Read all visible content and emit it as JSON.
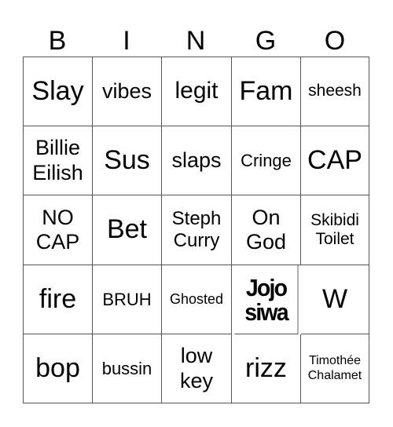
{
  "header": {
    "letters": [
      "B",
      "I",
      "N",
      "G",
      "O"
    ]
  },
  "board": {
    "rows": [
      [
        "Slay",
        "vibes",
        "legit",
        "Fam",
        "sheesh"
      ],
      [
        "Billie Eilish",
        "Sus",
        "slaps",
        "Cringe",
        "CAP"
      ],
      [
        "NO CAP",
        "Bet",
        "Steph Curry",
        "On God",
        "Skibidi Toilet"
      ],
      [
        "fire",
        "BRUH",
        "Ghosted",
        "Jojo siwa",
        "W"
      ],
      [
        "bop",
        "bussin",
        "low key",
        "rizz",
        "Timothée Chalamet"
      ]
    ]
  }
}
